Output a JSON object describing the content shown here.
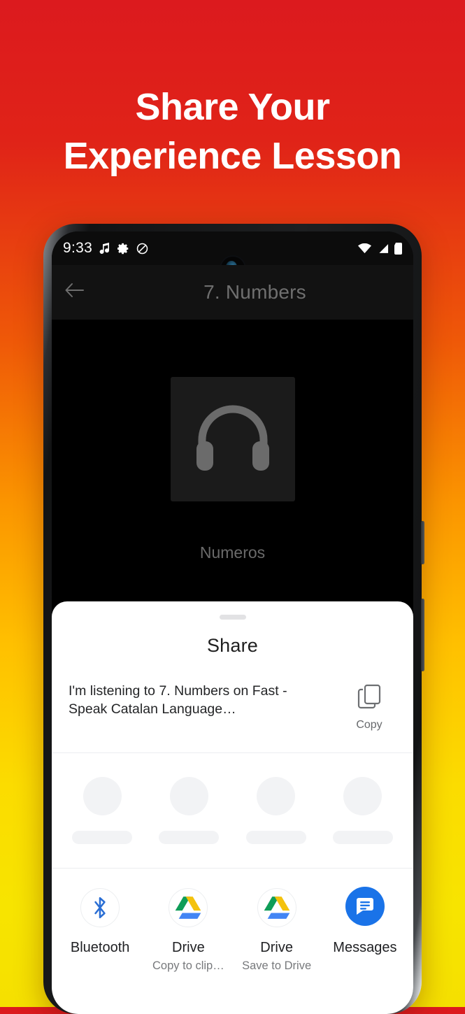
{
  "promo": {
    "headline_line1": "Share Your",
    "headline_line2": "Experience Lesson",
    "background_top_color": "#dc1a1e",
    "background_bottom_color": "#f5e000",
    "headline_color": "#ffffff"
  },
  "status_bar": {
    "clock": "9:33",
    "left_icons": [
      "music-note-icon",
      "settings-gear-icon",
      "do-not-disturb-icon"
    ],
    "right_icons": [
      "wifi-icon",
      "cellular-signal-icon",
      "battery-icon"
    ]
  },
  "app_bar": {
    "back_label": "←",
    "title": "7. Numbers"
  },
  "player": {
    "artwork_icon": "headphones-icon",
    "track_title": "Numeros"
  },
  "share_sheet": {
    "title": "Share",
    "preview_text": "I'm listening to 7. Numbers on Fast - Speak Catalan Language…",
    "copy": {
      "icon": "copy-icon",
      "label": "Copy"
    },
    "skeleton_placeholders": 4,
    "apps": [
      {
        "name": "Bluetooth",
        "subtitle": "",
        "icon": "bluetooth-icon",
        "color": "#2a6ed4"
      },
      {
        "name": "Drive",
        "subtitle": "Copy to clip…",
        "icon": "google-drive-icon",
        "color": "#0f9d58"
      },
      {
        "name": "Drive",
        "subtitle": "Save to Drive",
        "icon": "google-drive-icon",
        "color": "#0f9d58"
      },
      {
        "name": "Messages",
        "subtitle": "",
        "icon": "google-messages-icon",
        "color": "#1a73e8"
      }
    ]
  }
}
